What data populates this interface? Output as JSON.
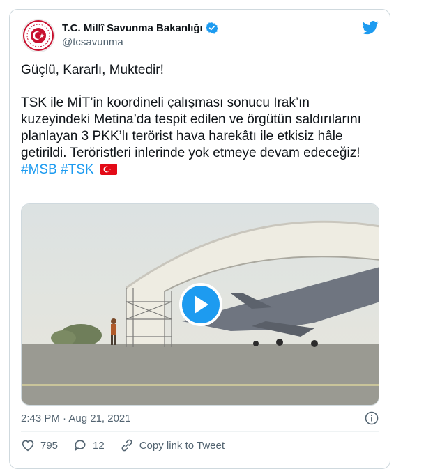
{
  "author": {
    "name": "T.C. Millî Savunma Bakanlığı",
    "handle": "@tcsavunma",
    "verified_icon": "verified-badge-icon"
  },
  "tweet": {
    "line1": "Güçlü, Kararlı, Muktedir!",
    "body": "TSK ile MİT’in koordineli çalışması sonucu Irak’ın kuzeyindeki Metina’da tespit edilen ve örgütün saldırılarını planlayan 3 PKK’lı terörist hava harekâtı ile etkisiz hâle getirildi. Teröristleri inlerinde yok etmeye devam edeceğiz!",
    "hashtags": "#MSB #TSK",
    "flag_icon": "turkey-flag-icon"
  },
  "meta": {
    "timestamp": "2:43 PM · Aug 21, 2021"
  },
  "actions": {
    "likes": "795",
    "replies": "12",
    "copy_link": "Copy link to Tweet"
  },
  "colors": {
    "accent": "#1d9bf0",
    "like": "#536471",
    "flag_red": "#e30a17"
  }
}
